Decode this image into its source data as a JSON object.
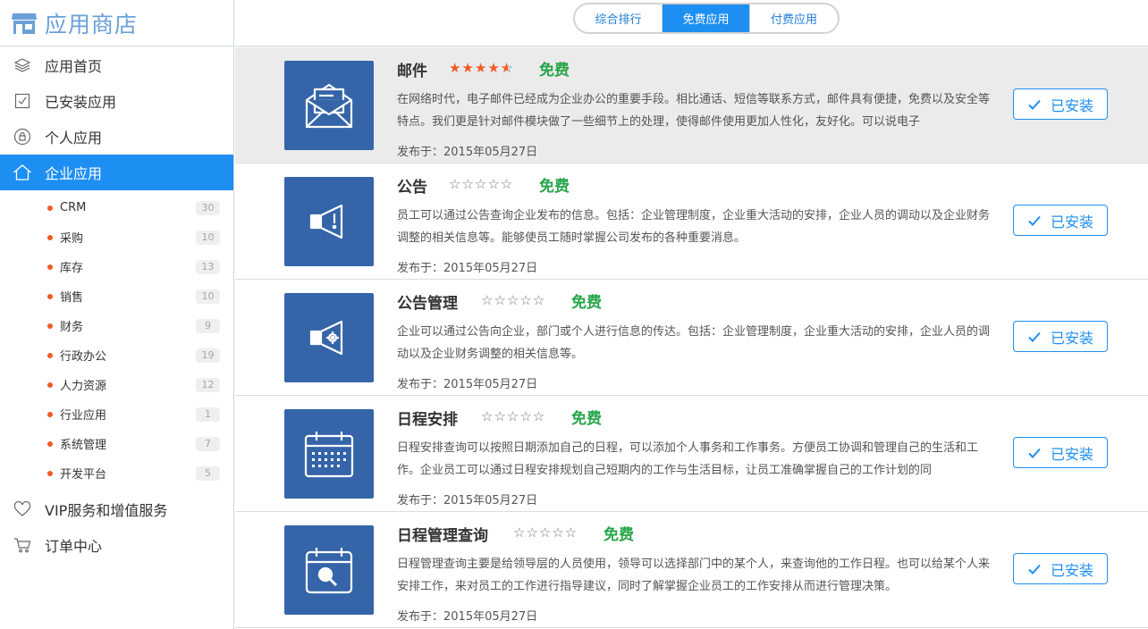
{
  "brand": {
    "title": "应用商店"
  },
  "sidebar": {
    "items": [
      {
        "label": "应用首页"
      },
      {
        "label": "已安装应用"
      },
      {
        "label": "个人应用"
      },
      {
        "label": "企业应用"
      },
      {
        "label": "VIP服务和增值服务"
      },
      {
        "label": "订单中心"
      }
    ],
    "sub_items": [
      {
        "label": "CRM",
        "count": "30"
      },
      {
        "label": "采购",
        "count": "10"
      },
      {
        "label": "库存",
        "count": "13"
      },
      {
        "label": "销售",
        "count": "10"
      },
      {
        "label": "财务",
        "count": "9"
      },
      {
        "label": "行政办公",
        "count": "19"
      },
      {
        "label": "人力资源",
        "count": "12"
      },
      {
        "label": "行业应用",
        "count": "1"
      },
      {
        "label": "系统管理",
        "count": "7"
      },
      {
        "label": "开发平台",
        "count": "5"
      }
    ]
  },
  "tabs": [
    {
      "label": "综合排行"
    },
    {
      "label": "免费应用"
    },
    {
      "label": "付费应用"
    }
  ],
  "apps": [
    {
      "name": "邮件",
      "rating": 4.5,
      "price": "免费",
      "description": "在网络时代，电子邮件已经成为企业办公的重要手段。相比通话、短信等联系方式，邮件具有便捷，免费以及安全等特点。我们更是针对邮件模块做了一些细节上的处理，使得邮件使用更加人性化，友好化。可以说电子",
      "date": "发布于：2015年05月27日",
      "button": "已安装",
      "icon": "mail-icon"
    },
    {
      "name": "公告",
      "rating": 0,
      "price": "免费",
      "description": "员工可以通过公告查询企业发布的信息。包括：企业管理制度，企业重大活动的安排，企业人员的调动以及企业财务调整的相关信息等。能够使员工随时掌握公司发布的各种重要消息。",
      "date": "发布于：2015年05月27日",
      "button": "已安装",
      "icon": "megaphone-icon"
    },
    {
      "name": "公告管理",
      "rating": 0,
      "price": "免费",
      "description": "企业可以通过公告向企业，部门或个人进行信息的传达。包括：企业管理制度，企业重大活动的安排，企业人员的调动以及企业财务调整的相关信息等。",
      "date": "发布于：2015年05月27日",
      "button": "已安装",
      "icon": "megaphone-gear-icon"
    },
    {
      "name": "日程安排",
      "rating": 0,
      "price": "免费",
      "description": "日程安排查询可以按照日期添加自己的日程，可以添加个人事务和工作事务。方便员工协调和管理自己的生活和工作。企业员工可以通过日程安排规划自己短期内的工作与生活目标，让员工准确掌握自己的工作计划的同",
      "date": "发布于：2015年05月27日",
      "button": "已安装",
      "icon": "calendar-icon"
    },
    {
      "name": "日程管理查询",
      "rating": 0,
      "price": "免费",
      "description": "日程管理查询主要是给领导层的人员使用，领导可以选择部门中的某个人，来查询他的工作日程。也可以给某个人来安排工作，来对员工的工作进行指导建议，同时了解掌握企业员工的工作安排从而进行管理决策。",
      "date": "发布于：2015年05月27日",
      "button": "已安装",
      "icon": "calendar-search-icon"
    }
  ]
}
